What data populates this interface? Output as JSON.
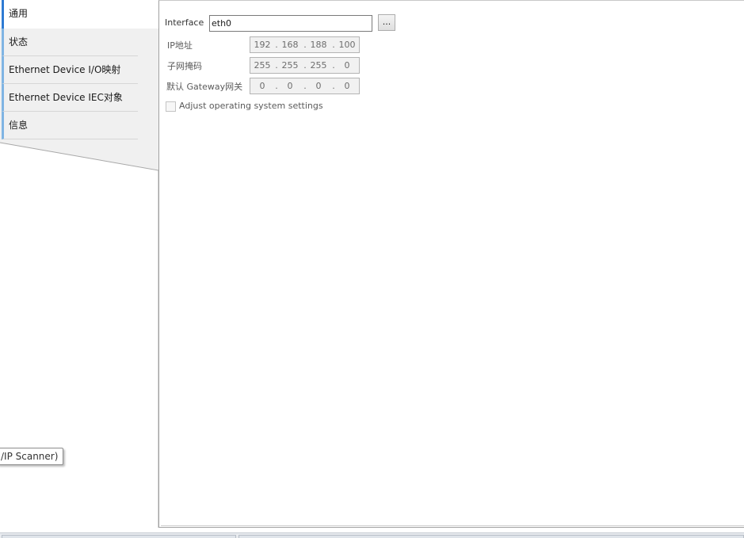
{
  "tabs": [
    {
      "label": "通用",
      "active": true
    },
    {
      "label": "状态",
      "active": false
    },
    {
      "label": "Ethernet Device I/O映射",
      "active": false
    },
    {
      "label": "Ethernet Device IEC对象",
      "active": false
    },
    {
      "label": "信息",
      "active": false
    }
  ],
  "tooltip": {
    "text": "/IP Scanner)"
  },
  "form": {
    "interface_label": "Interface",
    "interface_value": "eth0",
    "browse_label": "...",
    "ip_label": "IP地址",
    "ip_octets": [
      "192",
      "168",
      "188",
      "100"
    ],
    "subnet_label": "子网掩码",
    "subnet_octets": [
      "255",
      "255",
      "255",
      "0"
    ],
    "gateway_label": "默认 Gateway网关",
    "gateway_octets": [
      "0",
      "0",
      "0",
      "0"
    ],
    "checkbox_label": "Adjust operating system settings",
    "checkbox_checked": false
  },
  "colors": {
    "active_tab_accent": "#2f7bd3",
    "inactive_tab_accent": "#7fb4e3",
    "tab_strip_bg": "#f0f0f0",
    "disabled_field_bg": "#f1f1f1"
  }
}
